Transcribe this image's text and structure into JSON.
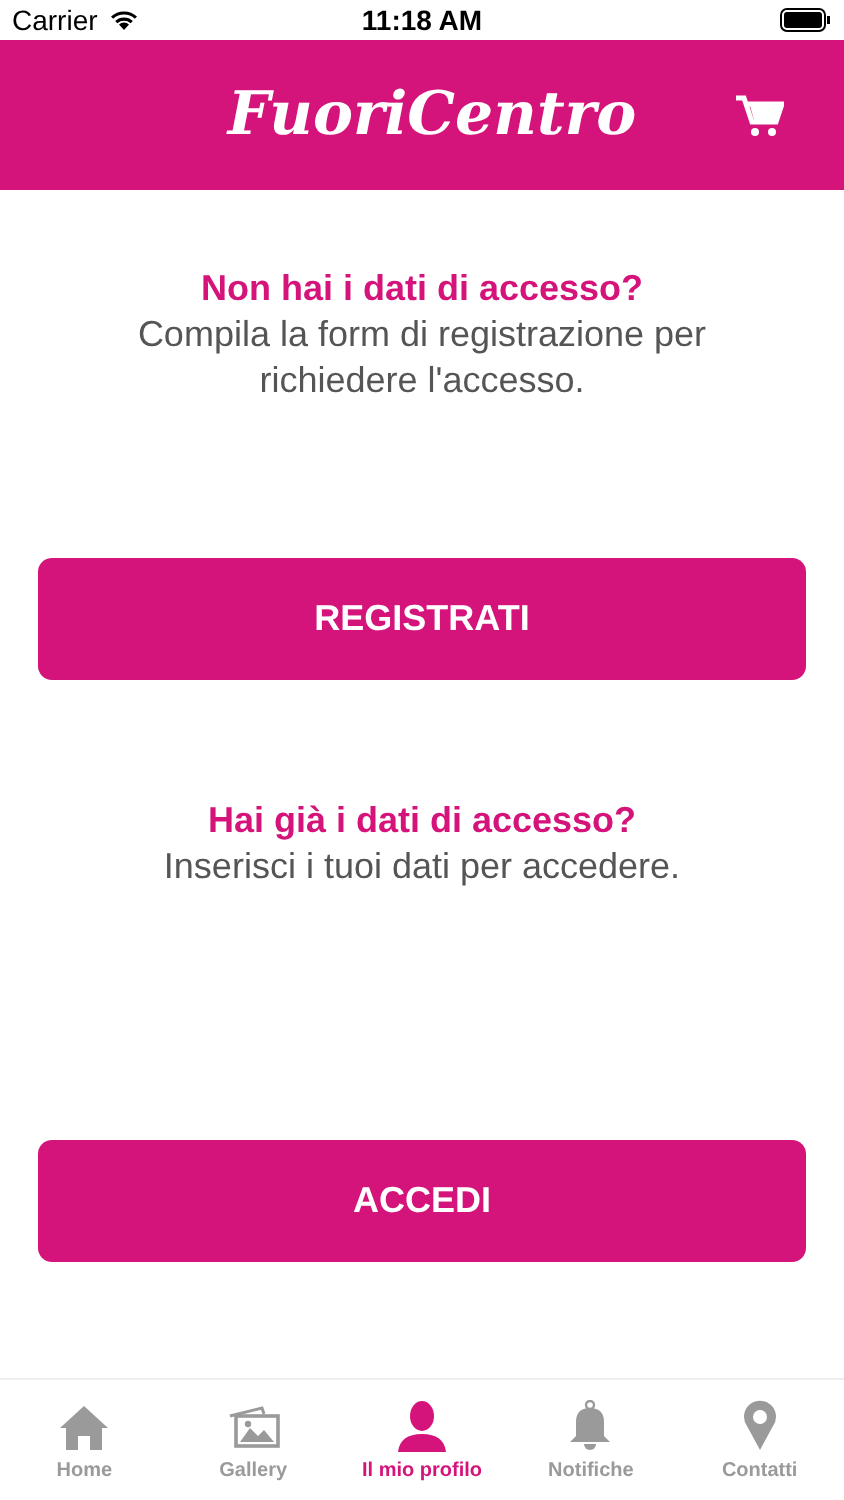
{
  "status_bar": {
    "carrier": "Carrier",
    "time": "11:18 AM"
  },
  "header": {
    "logo": "FuoriCentro"
  },
  "sections": [
    {
      "title": "Non hai i dati di accesso?",
      "text": "Compila la form di registrazione per richiedere l'accesso.",
      "button": "REGISTRATI"
    },
    {
      "title": "Hai già i dati di accesso?",
      "text": "Inserisci i tuoi dati per accedere.",
      "button": "ACCEDI"
    }
  ],
  "tabs": [
    {
      "label": "Home",
      "kind": "home",
      "selected": false
    },
    {
      "label": "Gallery",
      "kind": "gallery",
      "selected": false
    },
    {
      "label": "Il mio profilo",
      "kind": "profile",
      "selected": true
    },
    {
      "label": "Notifiche",
      "kind": "bell",
      "selected": false
    },
    {
      "label": "Contatti",
      "kind": "pin",
      "selected": false
    }
  ]
}
